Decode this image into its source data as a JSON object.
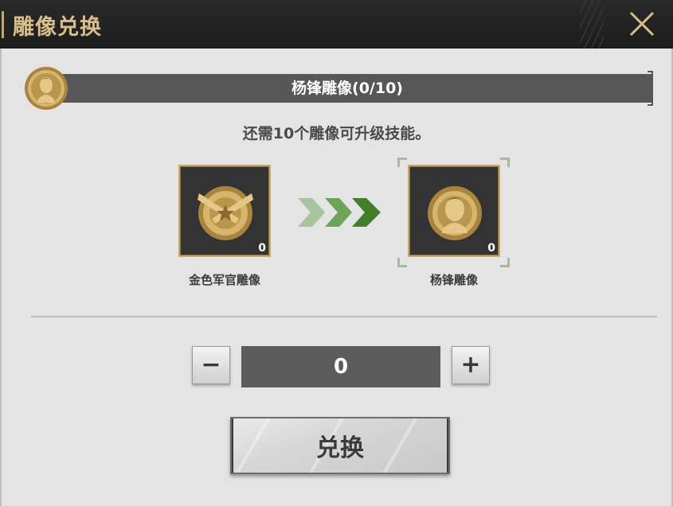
{
  "header": {
    "title": "雕像兑换",
    "close_icon": "close-x-icon"
  },
  "statue": {
    "name_progress": "杨锋雕像(0/10)",
    "portrait_icon": "portrait-medal-icon"
  },
  "hint": "还需10个雕像可升级技能。",
  "exchange": {
    "source": {
      "name": "金色军官雕像",
      "count": "0",
      "icon": "crossed-pistols-medal-icon"
    },
    "target": {
      "name": "杨锋雕像",
      "count": "0",
      "icon": "portrait-medal-icon"
    },
    "arrow_icon": "triple-chevron-right-icon"
  },
  "quantity": {
    "minus_label": "−",
    "value": "0",
    "plus_label": "+"
  },
  "action": {
    "label": "兑换"
  },
  "colors": {
    "gold": "#c8a66a",
    "arrow_green": "#3f7f2a",
    "panel_bg": "#e4e4e4",
    "bar_gray": "#575757"
  }
}
